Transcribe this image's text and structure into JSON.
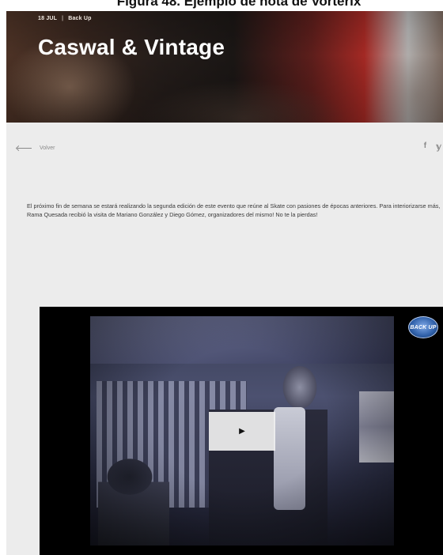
{
  "caption": "Figura 48. Ejemplo de nota de Vorterix",
  "hero": {
    "date": "18 JUL",
    "category": "Back Up",
    "title": "Caswal & Vintage"
  },
  "nav": {
    "back_label": "Volver"
  },
  "social": {
    "facebook": "f",
    "twitter": "🐦"
  },
  "article": {
    "body": "El próximo fin de semana se estará realizando la segunda edición de este evento que reúne al Skate con pasiones de épocas anteriores. Para interiorizarse más, Rama Quesada recibió la visita de Mariano González y Diego Gómez, organizadores del mismo! No te la pierdas!"
  },
  "video": {
    "logo_text": "BACK UP",
    "play_icon": "▶"
  },
  "colors": {
    "content_bg": "#ececec",
    "video_bg": "#000000",
    "text": "#3a3a3a"
  }
}
